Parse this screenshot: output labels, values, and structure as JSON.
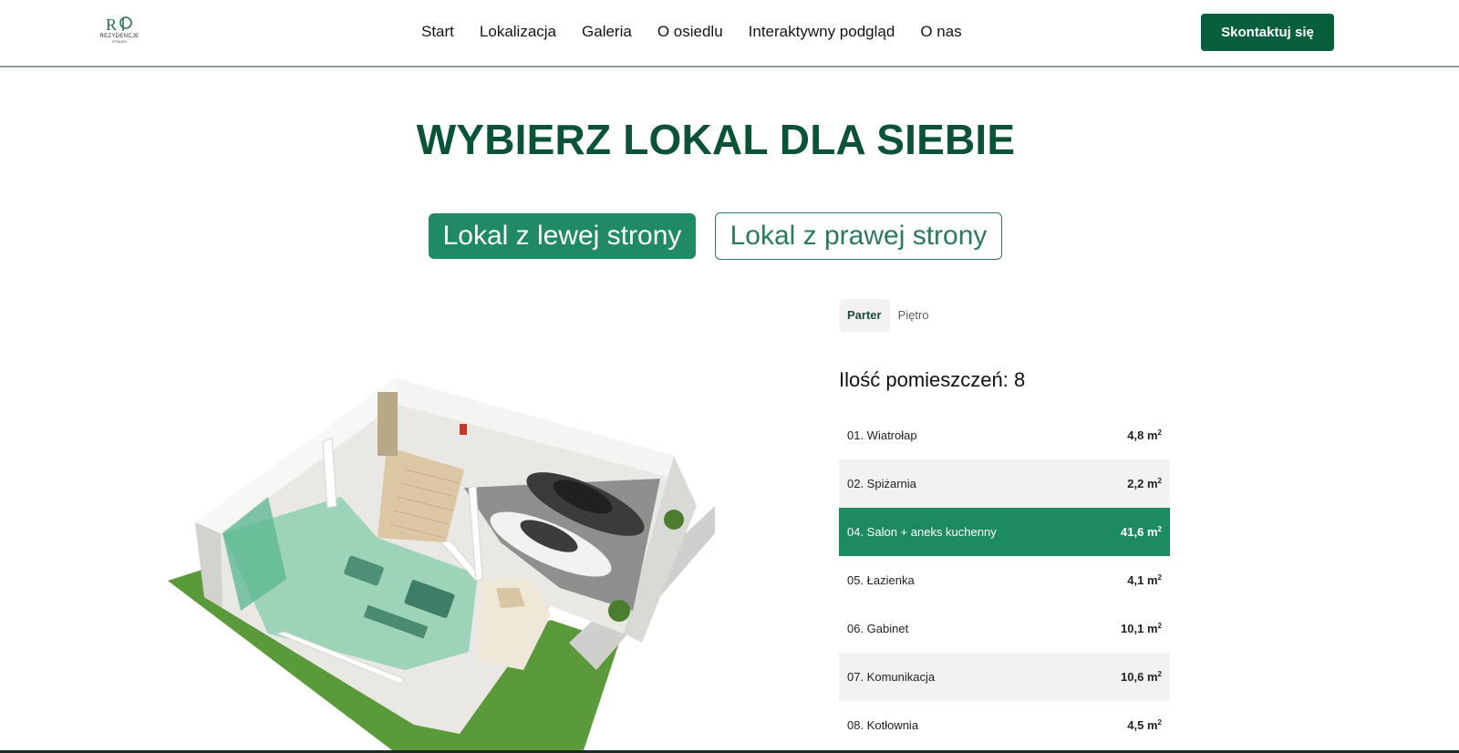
{
  "brand": {
    "logo_text": "REZYDENCJE",
    "logo_sub": "POWSIN"
  },
  "nav": {
    "items": [
      {
        "label": "Start"
      },
      {
        "label": "Lokalizacja"
      },
      {
        "label": "Galeria"
      },
      {
        "label": "O osiedlu"
      },
      {
        "label": "Interaktywny podgląd"
      },
      {
        "label": "O nas"
      }
    ],
    "cta_label": "Skontaktuj się"
  },
  "main": {
    "title": "WYBIERZ LOKAL DLA SIEBIE",
    "unit_tabs": [
      {
        "label": "Lokal z lewej strony",
        "active": true
      },
      {
        "label": "Lokal z prawej strony",
        "active": false
      }
    ],
    "floor_tabs": [
      {
        "label": "Parter",
        "active": true
      },
      {
        "label": "Piętro",
        "active": false
      }
    ],
    "room_count_label": "Ilość pomieszczeń: 8",
    "area_unit": "m",
    "area_exp": "2",
    "rooms": [
      {
        "name": "01. Wiatrołap",
        "area": "4,8"
      },
      {
        "name": "02. Spiżarnia",
        "area": "2,2"
      },
      {
        "name": "04. Salon + aneks kuchenny",
        "area": "41,6"
      },
      {
        "name": "05. Łazienka",
        "area": "4,1"
      },
      {
        "name": "06. Gabinet",
        "area": "10,1"
      },
      {
        "name": "07. Komunikacja",
        "area": "10,6"
      },
      {
        "name": "08. Kotłownia",
        "area": "4,5"
      }
    ]
  },
  "colors": {
    "brand_green": "#075f3e",
    "title_green": "#0a5336",
    "accent_green": "#1f8a64",
    "row_alt": "#f3f2f0"
  }
}
